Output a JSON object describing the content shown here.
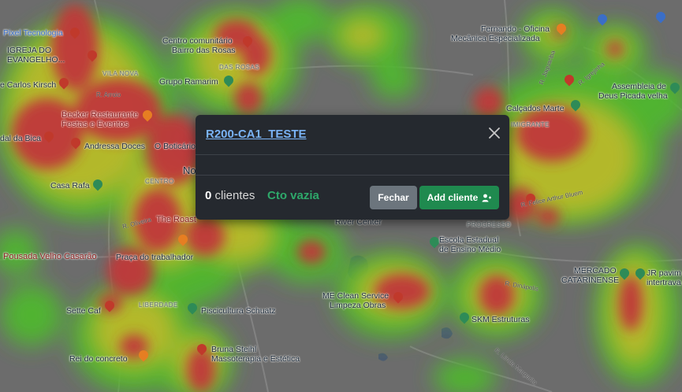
{
  "map": {
    "labels": [
      {
        "id": "pixel",
        "text": "Pixel Tecnologia",
        "style": "blue"
      },
      {
        "id": "igreja1",
        "text": "IGREJA DO",
        "style": "dark"
      },
      {
        "id": "igreja2",
        "text": "EVANGELHO...",
        "style": "dark"
      },
      {
        "id": "kirsch",
        "text": "e Carlos Kirsch",
        "style": "dark"
      },
      {
        "id": "becker1",
        "text": "Becker Restaurante",
        "style": "red"
      },
      {
        "id": "becker2",
        "text": "Festas e Eventos",
        "style": "red"
      },
      {
        "id": "dabica",
        "text": "dal da Bica",
        "style": "dark"
      },
      {
        "id": "andressa",
        "text": "Andressa Doces",
        "style": "dark"
      },
      {
        "id": "boticario",
        "text": "O Boticário",
        "style": "dark"
      },
      {
        "id": "casarafa",
        "text": "Casa Rafa",
        "style": "dark"
      },
      {
        "id": "roast",
        "text": "The Roast",
        "style": "red"
      },
      {
        "id": "pousada",
        "text": "Pousada Velho Casarão",
        "style": "red"
      },
      {
        "id": "praca",
        "text": "Praça do trabalhador",
        "style": "dark"
      },
      {
        "id": "settecaf",
        "text": "Sette Caf",
        "style": "dark"
      },
      {
        "id": "piscicultura",
        "text": "Piscicultura Schuatz",
        "style": "dark"
      },
      {
        "id": "reidoconcreto",
        "text": "Rei do concreto",
        "style": "dark"
      },
      {
        "id": "bruna1",
        "text": "Bruna Steihl",
        "style": "dark"
      },
      {
        "id": "bruna2",
        "text": "Massoterapia e Estética",
        "style": "dark"
      },
      {
        "id": "centro1",
        "text": "Centro comunitário",
        "style": "dark"
      },
      {
        "id": "centro2",
        "text": "Bairro das Rosas",
        "style": "dark"
      },
      {
        "id": "ramarim",
        "text": "Grupo Ramarim",
        "style": "dark"
      },
      {
        "id": "fernando1",
        "text": "Fernando - Oficina",
        "style": "dark"
      },
      {
        "id": "fernando2",
        "text": "Mecânica Especializada",
        "style": "dark"
      },
      {
        "id": "calcados",
        "text": "Calçados Marte",
        "style": "dark"
      },
      {
        "id": "assembleia1",
        "text": "Assembleia de",
        "style": "dark"
      },
      {
        "id": "assembleia2",
        "text": "Deus Picada velha",
        "style": "dark"
      },
      {
        "id": "river",
        "text": "River Center",
        "style": "dark"
      },
      {
        "id": "escola1",
        "text": "Escola Estadual",
        "style": "dark"
      },
      {
        "id": "escola2",
        "text": "de Ensino Médio",
        "style": "dark"
      },
      {
        "id": "mecl1",
        "text": "ME Clean Service",
        "style": "dark"
      },
      {
        "id": "mecl2",
        "text": "Limpeza Obras",
        "style": "dark"
      },
      {
        "id": "skm",
        "text": "SKM Estruturas",
        "style": "dark"
      },
      {
        "id": "mercado1",
        "text": "MERCADO",
        "style": "dark"
      },
      {
        "id": "mercado2",
        "text": "CATARINENSE",
        "style": "dark"
      },
      {
        "id": "jr1",
        "text": "JR pavim",
        "style": "dark"
      },
      {
        "id": "jr2",
        "text": "intertrava",
        "style": "dark"
      },
      {
        "id": "vilanova",
        "text": "VILA NOVA",
        "style": "district"
      },
      {
        "id": "dasrosas",
        "text": "DAS ROSAS",
        "style": "district"
      },
      {
        "id": "imigrante",
        "text": "IMIGRANTE",
        "style": "district"
      },
      {
        "id": "progresso",
        "text": "PROGRESSO",
        "style": "district"
      },
      {
        "id": "liberdade",
        "text": "LIBERDADE",
        "style": "district"
      },
      {
        "id": "centro",
        "text": "CENTRO",
        "style": "district"
      },
      {
        "id": "no",
        "text": "No",
        "style": "dark"
      },
      {
        "id": "rarroio",
        "text": "R. Arroio",
        "style": "street"
      },
      {
        "id": "rfelice",
        "text": "R. Felice Arthur Bluem",
        "style": "street"
      },
      {
        "id": "rjaguariba",
        "text": "R. Jaguariba",
        "style": "street"
      },
      {
        "id": "rigrejinha",
        "text": "R. Igrejinha",
        "style": "street"
      },
      {
        "id": "rdinapolis",
        "text": "R. Dinápolis",
        "style": "street"
      },
      {
        "id": "rdoliveira",
        "text": "R. Oliveira",
        "style": "street"
      },
      {
        "id": "rdorigata",
        "text": "R. Liinda Margarita",
        "style": "street"
      }
    ]
  },
  "popup": {
    "title": "R200-CA1_TESTE",
    "client_count": "0",
    "client_label": "clientes",
    "status": "Cto vazia",
    "close_label": "Fechar",
    "add_label": "Add cliente"
  },
  "colors": {
    "heat_red": "#c0393b",
    "heat_yellow": "#b9b92a",
    "heat_green": "#4fb82f",
    "modal_bg": "#25292f",
    "link": "#7ab3f5",
    "success": "#2ea86a"
  }
}
